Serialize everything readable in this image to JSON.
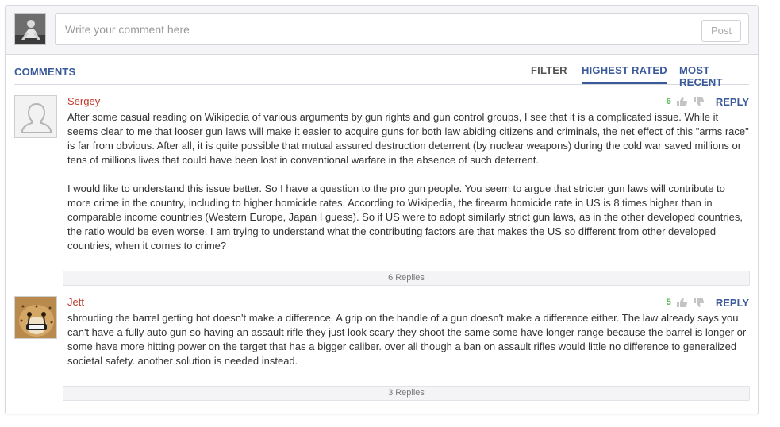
{
  "compose": {
    "placeholder": "Write your comment here",
    "post_label": "Post"
  },
  "tabs": {
    "comments": "COMMENTS",
    "filter": "FILTER",
    "highest_rated": "HIGHEST RATED",
    "most_recent": "MOST RECENT",
    "active": "HIGHEST RATED"
  },
  "comments": [
    {
      "author": "Sergey",
      "score": "6",
      "reply_label": "REPLY",
      "avatar_icon": "default-user-icon",
      "paragraphs": [
        "After some casual reading on Wikipedia of various arguments by gun rights and gun control groups, I see that it is a complicated issue. While it seems clear to me that looser gun laws will make it easier to acquire guns for both law abiding citizens and criminals, the net effect of this \"arms race\" is far from obvious. After all, it is quite possible that mutual assured destruction deterrent (by nuclear weapons) during the cold war saved millions or tens of millions lives that could have been lost in conventional warfare in the absence of such deterrent.",
        "I would like to understand this issue better. So I have a question to the pro gun people. You seem to argue that stricter gun laws will contribute to more crime in the country, including to higher homicide rates. According to Wikipedia, the firearm homicide rate in US is 8 times higher than in comparable income countries (Western Europe, Japan I guess). So if US were to adopt similarly strict gun laws, as in the other developed countries, the ratio would be even worse. I am trying to understand what the contributing factors are that makes the US so different from other developed countries, when it comes to crime?"
      ],
      "replies_label": "6 Replies"
    },
    {
      "author": "Jett",
      "score": "5",
      "reply_label": "REPLY",
      "avatar_icon": "cheetah-photo",
      "paragraphs": [
        "shrouding the barrel getting hot doesn't make a difference. A grip on the handle of a gun doesn't make a difference either. The law already says you can't have a fully auto gun so having an assault rifle they just look scary they shoot the same some have longer range because the barrel is longer or some have more hitting power on the target that has a bigger caliber. over all though a ban on assault rifles would little no difference to generalized societal safety. another solution is needed instead."
      ],
      "replies_label": "3 Replies"
    }
  ],
  "colors": {
    "accent": "#3b5a9a",
    "author": "#c0392b",
    "score": "#5cb85c"
  }
}
